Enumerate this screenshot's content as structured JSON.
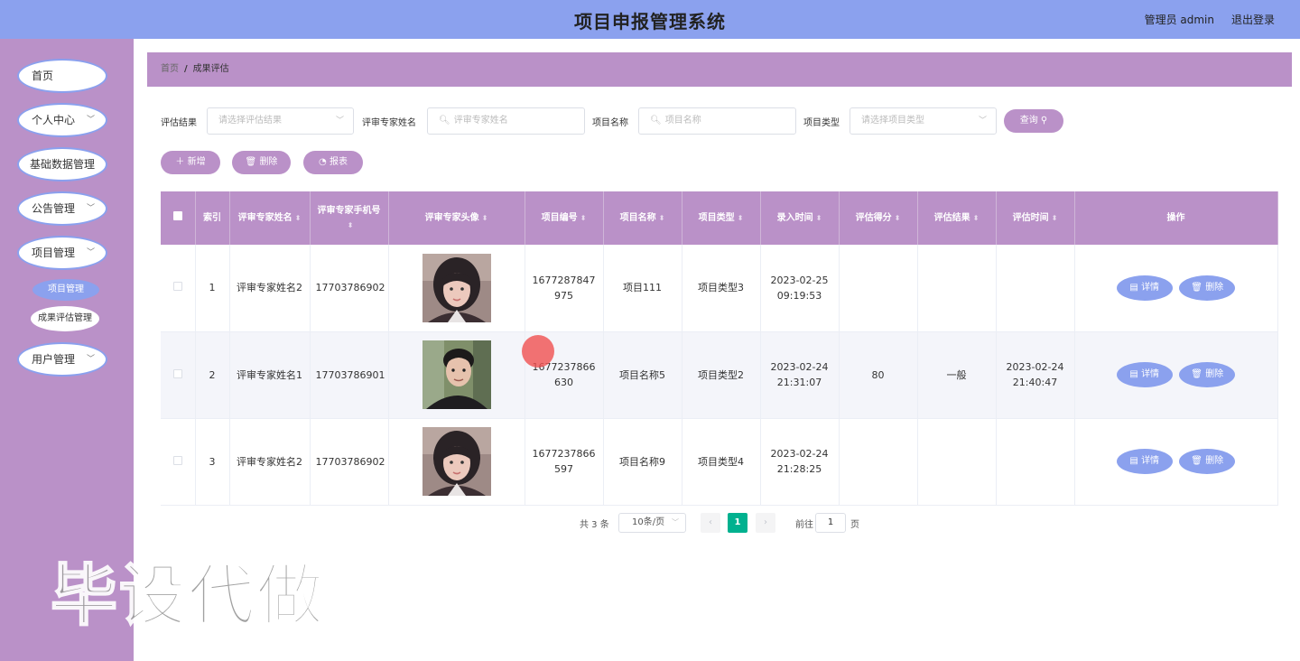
{
  "header": {
    "title": "项目申报管理系统",
    "user_label": "管理员 admin",
    "logout_label": "退出登录"
  },
  "sidebar": {
    "items": [
      {
        "label": "首页",
        "has_arrow": false
      },
      {
        "label": "个人中心",
        "has_arrow": true
      },
      {
        "label": "基础数据管理",
        "has_arrow": true
      },
      {
        "label": "公告管理",
        "has_arrow": true
      },
      {
        "label": "项目管理",
        "has_arrow": true
      },
      {
        "label": "用户管理",
        "has_arrow": true
      }
    ],
    "sub_items": [
      {
        "label": "项目管理",
        "active": true
      },
      {
        "label": "成果评估管理",
        "active": false
      }
    ]
  },
  "breadcrumb": {
    "home": "首页",
    "separator": "/",
    "current": "成果评估"
  },
  "search": {
    "result_label": "评估结果",
    "result_placeholder": "请选择评估结果",
    "expert_label": "评审专家姓名",
    "expert_placeholder": "评审专家姓名",
    "project_label": "项目名称",
    "project_placeholder": "项目名称",
    "type_label": "项目类型",
    "type_placeholder": "请选择项目类型",
    "query_label": "查询"
  },
  "actions": {
    "add_label": "新增",
    "delete_label": "删除",
    "report_label": "报表"
  },
  "table": {
    "headers": {
      "index": "索引",
      "expert_name": "评审专家姓名",
      "expert_phone": "评审专家手机号",
      "expert_avatar": "评审专家头像",
      "project_no": "项目编号",
      "project_name": "项目名称",
      "project_type": "项目类型",
      "entry_time": "录入时间",
      "score": "评估得分",
      "result": "评估结果",
      "eval_time": "评估时间",
      "ops": "操作"
    },
    "rows": [
      {
        "index": "1",
        "expert_name": "评审专家姓名2",
        "expert_phone": "17703786902",
        "avatar": "avatar-female-icon",
        "project_no": "1677287847975",
        "project_name": "项目111",
        "project_type": "项目类型3",
        "entry_time": "2023-02-25 09:19:53",
        "score": "",
        "result": "",
        "eval_time": ""
      },
      {
        "index": "2",
        "expert_name": "评审专家姓名1",
        "expert_phone": "17703786901",
        "avatar": "avatar-male-icon",
        "project_no": "1677237866630",
        "project_name": "项目名称5",
        "project_type": "项目类型2",
        "entry_time": "2023-02-24 21:31:07",
        "score": "80",
        "result": "一般",
        "eval_time": "2023-02-24 21:40:47"
      },
      {
        "index": "3",
        "expert_name": "评审专家姓名2",
        "expert_phone": "17703786902",
        "avatar": "avatar-female-icon",
        "project_no": "1677237866597",
        "project_name": "项目名称9",
        "project_type": "项目类型4",
        "entry_time": "2023-02-24 21:28:25",
        "score": "",
        "result": "",
        "eval_time": ""
      }
    ],
    "detail_label": "详情",
    "delete_label": "删除"
  },
  "pagination": {
    "total_text": "共 3 条",
    "page_size": "10条/页",
    "current_page": "1",
    "goto_label": "前往",
    "goto_value": "1",
    "page_unit": "页"
  },
  "watermark": "毕设代做",
  "colors": {
    "header_bg": "#8ba1ee",
    "sidebar_bg": "#ba91c8",
    "accent_purple": "#ba91c8",
    "accent_blue": "#8ba1ee",
    "page_active": "#00b18f"
  }
}
